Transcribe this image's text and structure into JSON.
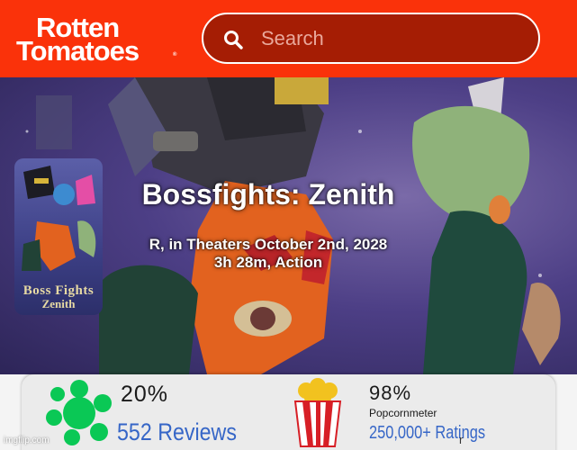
{
  "header": {
    "logo_line1": "Rotten",
    "logo_line2": "Tomatoes",
    "logo_reg": "®",
    "search_placeholder": "Search",
    "search_value": "",
    "icon": "search-icon",
    "brand_color": "#fa320a"
  },
  "movie": {
    "title": "Bossfights: Zenith",
    "rating_release": "R, in Theaters October 2nd, 2028",
    "runtime_genre": "3h 28m, Action",
    "poster_title_line1": "Boss Fights",
    "poster_title_line2": "Zenith"
  },
  "scores": {
    "tomatometer": "20%",
    "reviews": "552 Reviews",
    "tomatometer_icon": "green-splat-icon",
    "audience": "98%",
    "audience_label": "Popcornmeter",
    "ratings": "250,000+ Ratings",
    "ratings_overlap_char": "r",
    "audience_icon": "popcorn-bucket-icon",
    "link_color": "#3666c7",
    "splat_color": "#0ac855"
  },
  "watermark": "imgflip.com"
}
